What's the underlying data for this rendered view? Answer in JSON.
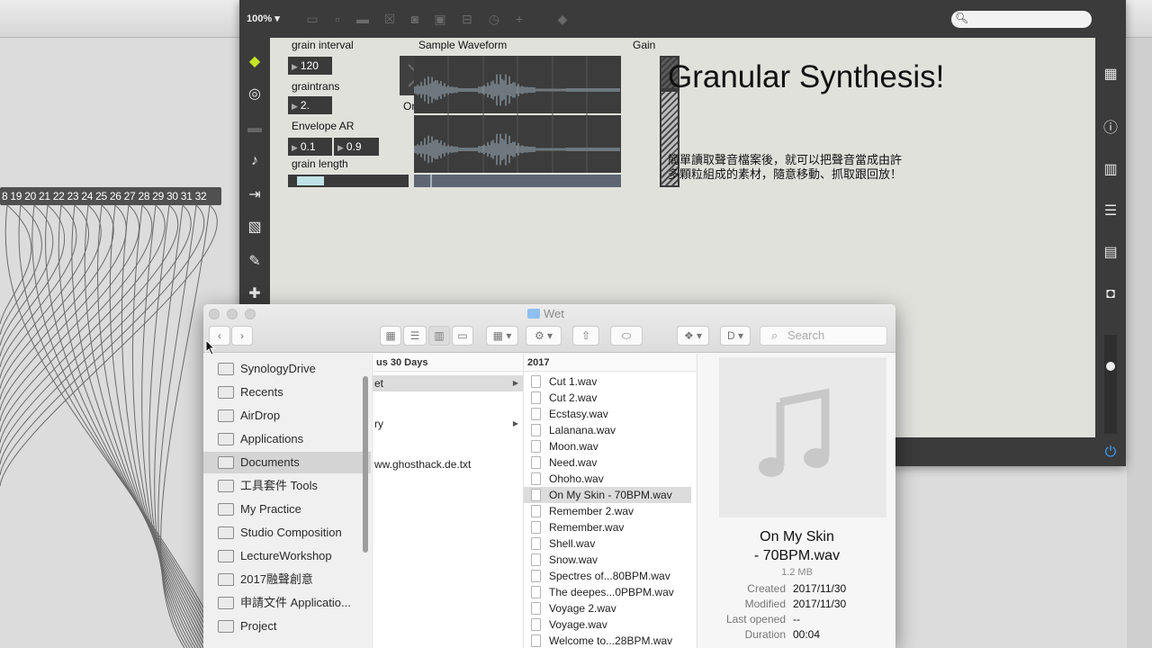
{
  "max": {
    "zoom": "100% ▾",
    "patch_strip": "8 19 20 21 22 23 24 25 26 27 28 29 30 31 32",
    "labels": {
      "grain_interval": "grain interval",
      "graintrans": "graintrans",
      "envelope": "Envelope AR",
      "grain_length": "grain length",
      "sample_waveform": "Sample Waveform",
      "gain": "Gain",
      "onoff": "On/Off"
    },
    "values": {
      "grain_interval": "120",
      "graintrans": "2.",
      "env_a": "0.1",
      "env_r": "0.9"
    },
    "title": "Granular Synthesis!",
    "desc_line1": "簡單讀取聲音檔案後，就可以把聲音當成由許",
    "desc_line2": "多顆粒組成的素材，隨意移動、抓取跟回放！"
  },
  "finder": {
    "title": "Wet",
    "search_placeholder": "Search",
    "sidebar": [
      {
        "label": "SynologyDrive",
        "icon": "folder-icon"
      },
      {
        "label": "Recents",
        "icon": "recents-icon"
      },
      {
        "label": "AirDrop",
        "icon": "airdrop-icon"
      },
      {
        "label": "Applications",
        "icon": "applications-icon"
      },
      {
        "label": "Documents",
        "icon": "documents-icon",
        "selected": true
      },
      {
        "label": "工具套件 Tools",
        "icon": "folder-icon"
      },
      {
        "label": "My Practice",
        "icon": "folder-icon"
      },
      {
        "label": "Studio Composition",
        "icon": "folder-icon"
      },
      {
        "label": "LectureWorkshop",
        "icon": "folder-icon"
      },
      {
        "label": "2017融聲創意",
        "icon": "folder-icon"
      },
      {
        "label": "申請文件 Applicatio...",
        "icon": "folder-icon"
      },
      {
        "label": "Project",
        "icon": "folder-icon"
      }
    ],
    "col1": {
      "header": "us 30 Days",
      "rows": [
        "et",
        "ry",
        "ww.ghosthack.de.txt"
      ]
    },
    "col2": {
      "header": "2017",
      "files": [
        "Cut 1.wav",
        "Cut 2.wav",
        "Ecstasy.wav",
        "Lalanana.wav",
        "Moon.wav",
        "Need.wav",
        "Ohoho.wav",
        "On My Skin - 70BPM.wav",
        "Remember 2.wav",
        "Remember.wav",
        "Shell.wav",
        "Snow.wav",
        "Spectres of...80BPM.wav",
        "The deepes...0PBPM.wav",
        "Voyage 2.wav",
        "Voyage.wav",
        "Welcome to...28BPM.wav"
      ],
      "selected_index": 7
    },
    "preview": {
      "name_line1": "On My Skin",
      "name_line2": "- 70BPM.wav",
      "size": "1.2 MB",
      "meta": [
        {
          "k": "Created",
          "v": "2017/11/30"
        },
        {
          "k": "Modified",
          "v": "2017/11/30"
        },
        {
          "k": "Last opened",
          "v": "--"
        },
        {
          "k": "Duration",
          "v": "00:04"
        }
      ]
    }
  },
  "colors": {
    "max_dark": "#3b3b3b",
    "canvas": "#e1e1dc",
    "accent_cube": "#c7e626",
    "power": "#3aa0ff"
  }
}
